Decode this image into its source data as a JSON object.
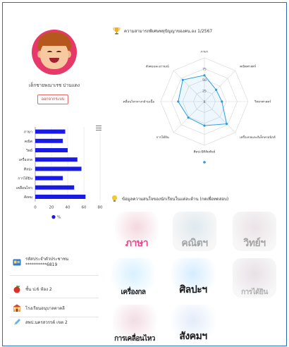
{
  "profile": {
    "name": "เด็กชายพณาเรช ปานแดง",
    "logout_label": "ออกจากระบบ"
  },
  "info": [
    {
      "label": "รหัสประจำตัวประชาชน",
      "value": "**********6819",
      "icon": "id-card-icon"
    },
    {
      "label": "ชั้น ป.6 ห้อง 2",
      "icon": "apple-icon"
    },
    {
      "label": "โรงเรียนอนุบาลตาคลี",
      "icon": "school-icon"
    },
    {
      "label": "สพป.นครสวรรค์ เขต 2",
      "icon": "pen-icon"
    }
  ],
  "radar_title": "ความสามารถพิเศษพหุปัญญาของคน.อง 1/2567",
  "subjects_title": "ข้อมูลความสนใจของนักเรียนในแต่ละด้าน (กดเพื่อทดสอบ)",
  "subjects": [
    {
      "label": "ภาษา",
      "color": "#e04a8a",
      "bg": "#f4d8e0",
      "active": true
    },
    {
      "label": "คณิตฯ",
      "color": "#8a8a8a",
      "bg": "#dfe9ef",
      "active": false
    },
    {
      "label": "วิทย์ฯ",
      "color": "#8a8a8a",
      "bg": "#ebe3e7",
      "active": false
    },
    {
      "label": "เครื่องกล",
      "color": "#1a1a1a",
      "bg": "#d8f0ff",
      "active": true
    },
    {
      "label": "ศิลปะฯ",
      "color": "#1a1a1a",
      "bg": "#d5ecff",
      "active": true
    },
    {
      "label": "การได้ยิน",
      "color": "#9a9a9a",
      "bg": "#e8e0e6",
      "active": false
    },
    {
      "label": "การเคลื่อนไหว",
      "color": "#1a1a1a",
      "bg": "#f2dce4",
      "active": true
    },
    {
      "label": "สังคมฯ",
      "color": "#1a1a1a",
      "bg": "#e4ecfa",
      "active": true
    }
  ],
  "chart_data": [
    {
      "type": "bar",
      "orientation": "horizontal",
      "categories": [
        "ภาษา",
        "คณิต",
        "วิทย์",
        "เครื่องกล",
        "ศิลปะ",
        "การได้ยิน",
        "เคลื่อนไหว",
        "สังคม"
      ],
      "values": [
        37,
        34,
        40,
        52,
        57,
        34,
        48,
        62
      ],
      "xticks": [
        "0",
        "20",
        "40",
        "60",
        "80"
      ],
      "xlim": [
        0,
        80
      ],
      "legend": "%",
      "color": "#1a1ae6"
    },
    {
      "type": "radar",
      "categories": [
        "ภาษา",
        "คณิตศาสตร์",
        "วิทยาศาสตร์",
        "เครื่องกลและอิเล็กทรอนิกส์",
        "ศิลปะมิติสัมพันธ์",
        "การได้ยิน",
        "การเคลื่อนไหวทางกล้ามเนื้อ",
        "สังคมและอารมณ์"
      ],
      "values": [
        60,
        38,
        40,
        72,
        55,
        52,
        60,
        70
      ],
      "rings": [
        "0",
        "25",
        "50",
        "75",
        "100"
      ],
      "rlim": [
        0,
        100
      ],
      "color": "#2a9de0"
    }
  ]
}
